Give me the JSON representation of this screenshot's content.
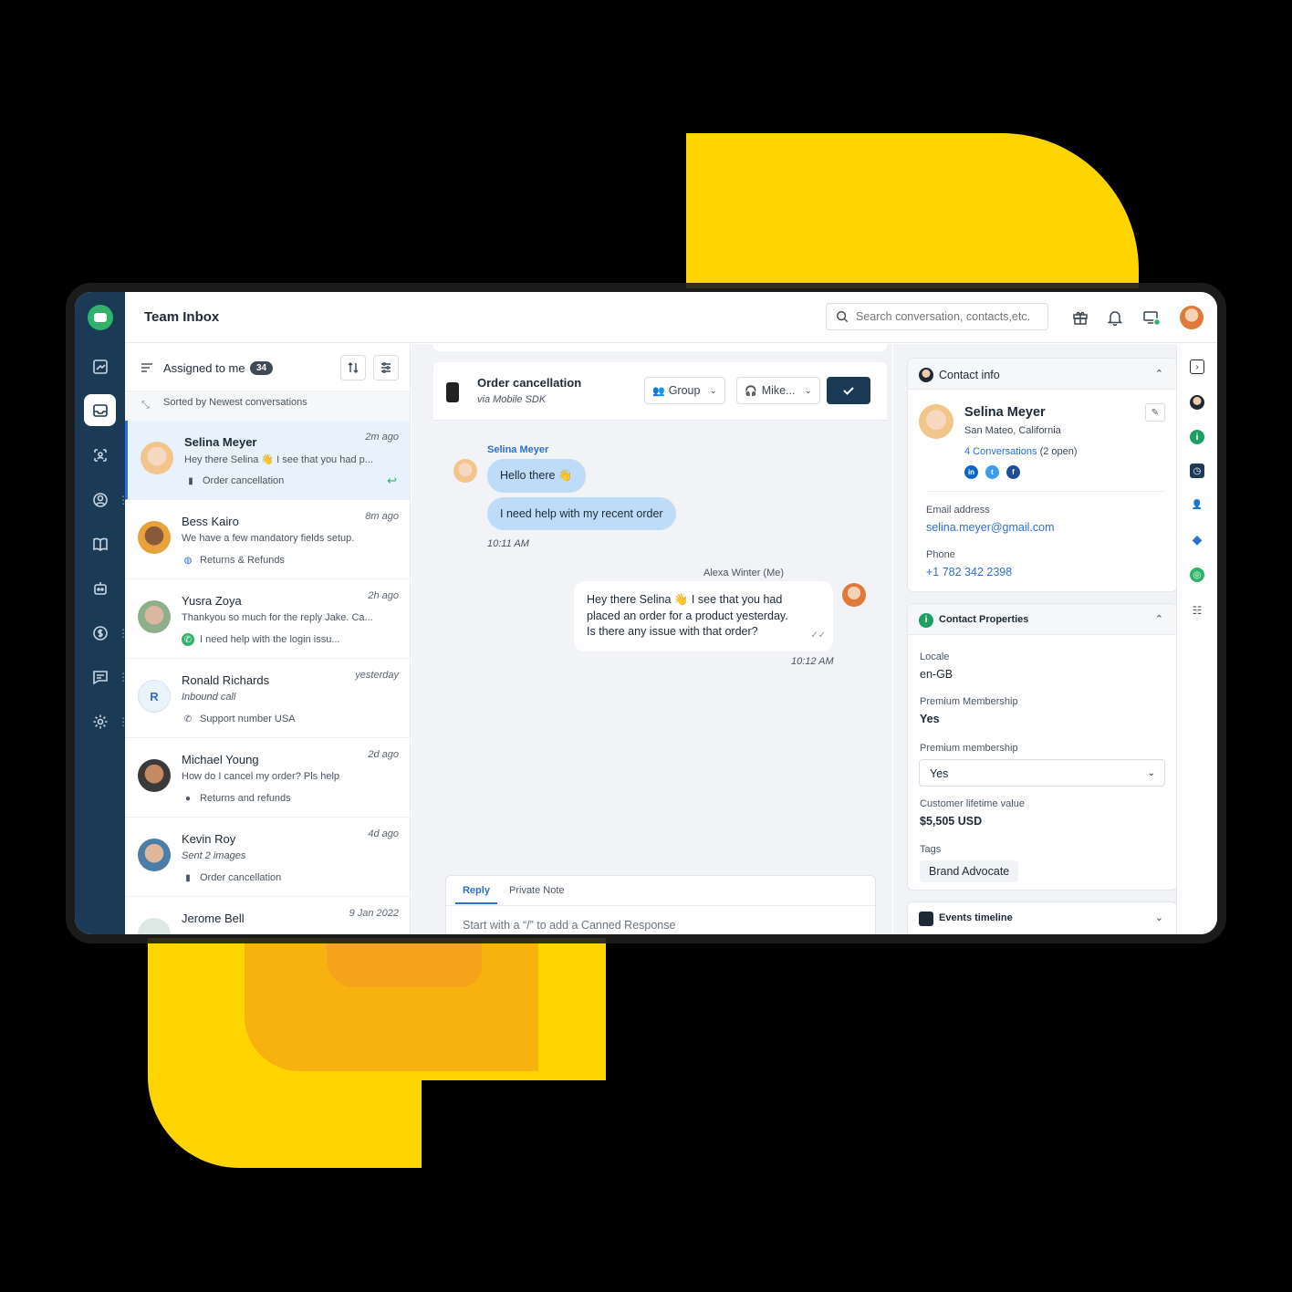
{
  "app": {
    "title": "Team Inbox"
  },
  "search": {
    "placeholder": "Search conversation, contacts,etc."
  },
  "icons": {
    "nav": [
      "dashboard-icon",
      "inbox-icon",
      "crm-icon",
      "contacts-icon",
      "knowledge-base-icon",
      "bot-icon",
      "billing-icon",
      "chat-icon",
      "settings-icon"
    ],
    "top": [
      "gift-icon",
      "bell-icon",
      "monitor-status-icon"
    ],
    "rail": [
      "panel-toggle-icon",
      "contact-icon",
      "info-icon",
      "timeline-icon",
      "user-settings-icon",
      "diamond-icon",
      "support-icon",
      "sliders-icon"
    ]
  },
  "colors": {
    "nav_bg": "#1B3A56",
    "accent": "#2C6FD1",
    "brand_green": "#2FB26A",
    "bubble_in": "#BEDBF8",
    "yellow": "#FFD500"
  },
  "conversation_list": {
    "filter_label": "Assigned to me",
    "count": "34",
    "sort_text": "Sorted by Newest conversations",
    "items": [
      {
        "name": "Selina Meyer",
        "time": "2m ago",
        "preview": "Hey there Selina 👋 I see that you had p...",
        "meta": "Order cancellation",
        "meta_icon": "mobile-icon"
      },
      {
        "name": "Bess Kairo",
        "time": "8m ago",
        "preview": "We have a few mandatory fields setup.",
        "meta": "Returns & Refunds",
        "meta_icon": "globe-icon"
      },
      {
        "name": "Yusra Zoya",
        "time": "2h ago",
        "preview": "Thankyou so much for the reply Jake. Ca...",
        "meta": "I need help with the login issu...",
        "meta_icon": "whatsapp-icon"
      },
      {
        "name": "Ronald Richards",
        "time": "yesterday",
        "preview": "Inbound call",
        "meta": "Support number USA",
        "meta_icon": "phone-icon",
        "initial": "R"
      },
      {
        "name": "Michael Young",
        "time": "2d ago",
        "preview": "How do I cancel my order? Pls help",
        "meta": "Returns and refunds",
        "meta_icon": "apple-icon"
      },
      {
        "name": "Kevin Roy",
        "time": "4d ago",
        "preview": "Sent 2 images",
        "meta": "Order cancellation",
        "meta_icon": "mobile-icon"
      },
      {
        "name": "Jerome Bell",
        "time": "9 Jan 2022",
        "preview": "",
        "meta": "",
        "meta_icon": ""
      }
    ]
  },
  "chat": {
    "title": "Order cancellation",
    "subtitle": "via Mobile SDK",
    "group_label": "Group",
    "agent_label": "Mike...",
    "incoming_sender": "Selina Meyer",
    "incoming_1": "Hello there 👋",
    "incoming_2": "I need help with my recent order",
    "incoming_time": "10:11 AM",
    "outgoing_sender": "Alexa Winter (Me)",
    "outgoing_line1": "Hey there Selina 👋 I see that you had",
    "outgoing_line2": "placed an order for a product yesterday.",
    "outgoing_line3": "Is there any issue with that order?",
    "outgoing_time": "10:12 AM",
    "tab_reply": "Reply",
    "tab_note": "Private Note",
    "reply_placeholder": "Start with a “/” to add a Canned Response"
  },
  "contact": {
    "header": "Contact info",
    "name": "Selina Meyer",
    "location": "San Mateo, California",
    "conversations_link": "4 Conversations",
    "conversations_open": "(2 open)",
    "email_label": "Email address",
    "email": "selina.meyer@gmail.com",
    "phone_label": "Phone",
    "phone": "+1 782 342 2398"
  },
  "properties": {
    "header": "Contact Properties",
    "locale_label": "Locale",
    "locale": "en-GB",
    "premium_label": "Premium Membership",
    "premium": "Yes",
    "premium_select_label": "Premium membership",
    "premium_select": "Yes",
    "ltv_label": "Customer lifetime value",
    "ltv": "$5,505 USD",
    "tags_label": "Tags",
    "tag": "Brand Advocate"
  },
  "events": {
    "header": "Events timeline"
  }
}
